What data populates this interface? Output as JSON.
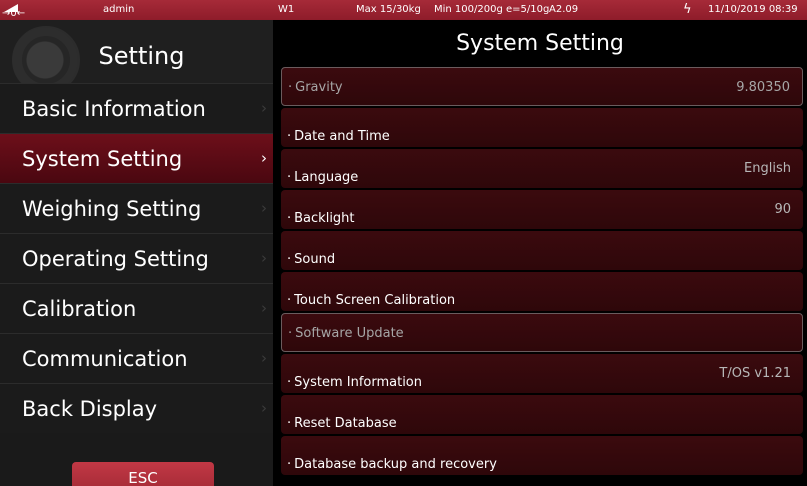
{
  "status_bar": {
    "zero_indicator": "→0←",
    "user": "admin",
    "scale": "W1",
    "max": "Max 15/30kg",
    "min": "Min 100/200g e=5/10g",
    "version": "A2.09",
    "power_icon": "lightning-bolt-icon",
    "datetime": "11/10/2019 08:39"
  },
  "sidebar": {
    "title": "Setting",
    "items": [
      {
        "label": "Basic Information",
        "active": false
      },
      {
        "label": "System Setting",
        "active": true
      },
      {
        "label": "Weighing Setting",
        "active": false
      },
      {
        "label": "Operating Setting",
        "active": false
      },
      {
        "label": "Calibration",
        "active": false
      },
      {
        "label": "Communication",
        "active": false
      },
      {
        "label": "Back Display",
        "active": false
      }
    ],
    "esc_label": "ESC",
    "chevron": "›"
  },
  "main": {
    "title": "System Setting",
    "rows": [
      {
        "label": "Gravity",
        "value": "9.80350",
        "disabled": true
      },
      {
        "label": "Date and Time",
        "value": "",
        "disabled": false
      },
      {
        "label": "Language",
        "value": "English",
        "disabled": false
      },
      {
        "label": "Backlight",
        "value": "90",
        "disabled": false
      },
      {
        "label": "Sound",
        "value": "",
        "disabled": false
      },
      {
        "label": "Touch Screen Calibration",
        "value": "",
        "disabled": false
      },
      {
        "label": "Software Update",
        "value": "",
        "disabled": true
      },
      {
        "label": "System Information",
        "value": "T/OS v1.21",
        "disabled": false
      },
      {
        "label": "Reset Database",
        "value": "",
        "disabled": false
      },
      {
        "label": "Database backup and recovery",
        "value": "",
        "disabled": false
      }
    ]
  },
  "colors": {
    "accent": "#a62a38",
    "active_item": "#5b0b15",
    "row_bg": "#35080c"
  }
}
